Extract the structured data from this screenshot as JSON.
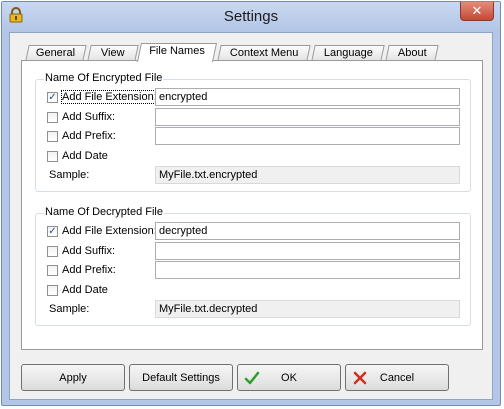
{
  "window": {
    "title": "Settings",
    "close_glyph": "✕"
  },
  "tabs": [
    {
      "label": "General"
    },
    {
      "label": "View"
    },
    {
      "label": "File Names",
      "active": true
    },
    {
      "label": "Context Menu"
    },
    {
      "label": "Language"
    },
    {
      "label": "About"
    }
  ],
  "encrypted": {
    "title": "Name Of Encrypted File",
    "add_extension": {
      "label": "Add File Extension:",
      "checked": true,
      "value": "encrypted"
    },
    "add_suffix": {
      "label": "Add Suffix:",
      "checked": false,
      "value": ""
    },
    "add_prefix": {
      "label": "Add Prefix:",
      "checked": false,
      "value": ""
    },
    "add_date": {
      "label": "Add Date",
      "checked": false
    },
    "sample_label": "Sample:",
    "sample_value": "MyFile.txt.encrypted"
  },
  "decrypted": {
    "title": "Name Of Decrypted File",
    "add_extension": {
      "label": "Add File Extension:",
      "checked": true,
      "value": "decrypted"
    },
    "add_suffix": {
      "label": "Add Suffix:",
      "checked": false,
      "value": ""
    },
    "add_prefix": {
      "label": "Add Prefix:",
      "checked": false,
      "value": ""
    },
    "add_date": {
      "label": "Add Date",
      "checked": false
    },
    "sample_label": "Sample:",
    "sample_value": "MyFile.txt.decrypted"
  },
  "buttons": {
    "apply": "Apply",
    "default_settings": "Default Settings",
    "ok": "OK",
    "cancel": "Cancel"
  },
  "colors": {
    "title_bar": "#b4c6e6",
    "close_button": "#c74735",
    "ok_check": "#2e9e2e",
    "cancel_x": "#d03020"
  },
  "icons": {
    "app": "lock-icon",
    "ok": "checkmark-icon",
    "cancel": "red-x-icon"
  }
}
